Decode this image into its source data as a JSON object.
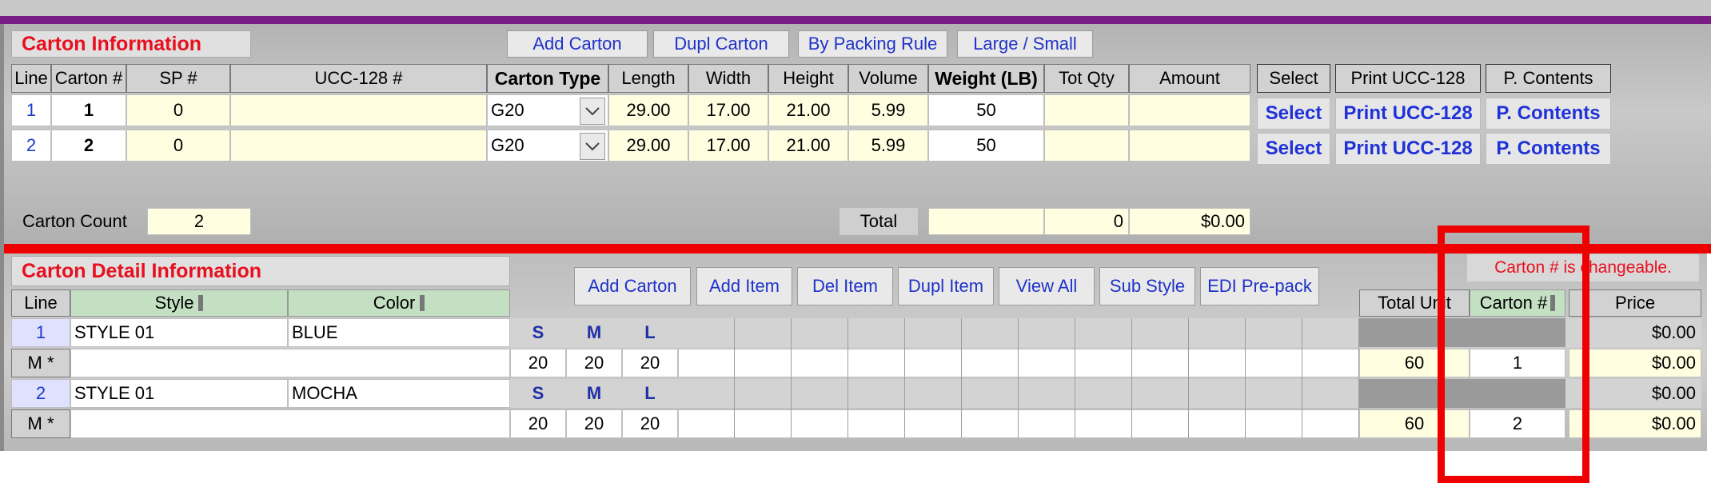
{
  "carton_info": {
    "title": "Carton  Information",
    "buttons": [
      "Add Carton",
      "Dupl Carton",
      "By Packing Rule",
      "Large / Small"
    ],
    "headers": [
      "Line",
      "Carton #",
      "SP #",
      "UCC-128 #",
      "Carton Type",
      "Length",
      "Width",
      "Height",
      "Volume",
      "Weight (LB)",
      "Tot Qty",
      "Amount",
      "Select",
      "Print UCC-128",
      "P. Contents"
    ],
    "rows": [
      {
        "line": "1",
        "carton": "1",
        "sp": "0",
        "ucc": "",
        "type": "G20",
        "length": "29.00",
        "width": "17.00",
        "height": "21.00",
        "volume": "5.99",
        "weight": "50",
        "tot_qty": "",
        "amount": ""
      },
      {
        "line": "2",
        "carton": "2",
        "sp": "0",
        "ucc": "",
        "type": "G20",
        "length": "29.00",
        "width": "17.00",
        "height": "21.00",
        "volume": "5.99",
        "weight": "50",
        "tot_qty": "",
        "amount": ""
      }
    ],
    "row_buttons": {
      "select": "Select",
      "print": "Print UCC-128",
      "contents": "P. Contents"
    },
    "carton_count_label": "Carton Count",
    "carton_count": "2",
    "total_label": "Total",
    "total_weight": "",
    "total_qty": "0",
    "total_amount": "$0.00"
  },
  "detail": {
    "title": "Carton Detail Information",
    "buttons": [
      "Add Carton",
      "Add Item",
      "Del Item",
      "Dupl Item",
      "View All",
      "Sub Style",
      "EDI Pre-pack"
    ],
    "notice": "Carton # is changeable.",
    "headers": {
      "line": "Line",
      "style": "Style",
      "color": "Color",
      "total_unit": "Total Unit",
      "carton": "Carton #",
      "price": "Price"
    },
    "items": [
      {
        "line": "1",
        "style": "STYLE 01",
        "color": "BLUE",
        "sizes": [
          "S",
          "M",
          "L"
        ],
        "sub_label": "M *",
        "qtys": [
          "20",
          "20",
          "20"
        ],
        "total_unit": "60",
        "carton": "1",
        "price_top": "$0.00",
        "price_bottom": "$0.00"
      },
      {
        "line": "2",
        "style": "STYLE 01",
        "color": "MOCHA",
        "sizes": [
          "S",
          "M",
          "L"
        ],
        "sub_label": "M *",
        "qtys": [
          "20",
          "20",
          "20"
        ],
        "total_unit": "60",
        "carton": "2",
        "price_top": "$0.00",
        "price_bottom": "$0.00"
      }
    ]
  },
  "colors": {
    "accent_purple": "#7a1c86",
    "divider_red": "#ef0000",
    "title_red": "#e8101f",
    "link_blue": "#1f32d9",
    "field_yellow": "#fffee0",
    "highlight_box": "#ee0000"
  }
}
